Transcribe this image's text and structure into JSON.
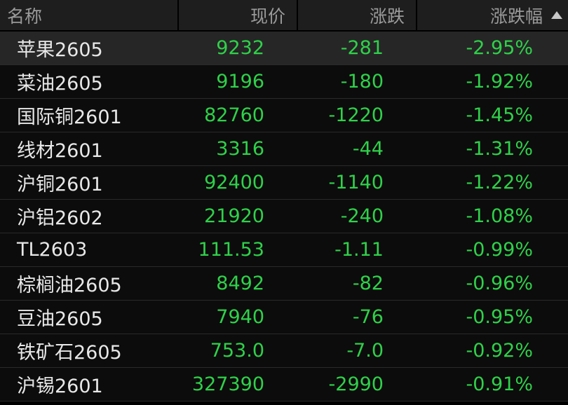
{
  "colors": {
    "down": "#2fd14a",
    "text": "#e8e8e8",
    "header_text": "#9a9a9a",
    "header_bg": "#1e1e1e",
    "selected_row_bg": "#262626"
  },
  "header": {
    "name": "名称",
    "price": "现价",
    "change": "涨跌",
    "pct": "涨跌幅",
    "sort_icon": "sort-ascending-triangle-icon"
  },
  "rows": [
    {
      "name": "苹果2605",
      "price": "9232",
      "change": "-281",
      "pct": "-2.95%"
    },
    {
      "name": "菜油2605",
      "price": "9196",
      "change": "-180",
      "pct": "-1.92%"
    },
    {
      "name": "国际铜2601",
      "price": "82760",
      "change": "-1220",
      "pct": "-1.45%"
    },
    {
      "name": "线材2601",
      "price": "3316",
      "change": "-44",
      "pct": "-1.31%"
    },
    {
      "name": "沪铜2601",
      "price": "92400",
      "change": "-1140",
      "pct": "-1.22%"
    },
    {
      "name": "沪铝2602",
      "price": "21920",
      "change": "-240",
      "pct": "-1.08%"
    },
    {
      "name": "TL2603",
      "price": "111.53",
      "change": "-1.11",
      "pct": "-0.99%"
    },
    {
      "name": "棕榈油2605",
      "price": "8492",
      "change": "-82",
      "pct": "-0.96%"
    },
    {
      "name": "豆油2605",
      "price": "7940",
      "change": "-76",
      "pct": "-0.95%"
    },
    {
      "name": "铁矿石2605",
      "price": "753.0",
      "change": "-7.0",
      "pct": "-0.92%"
    },
    {
      "name": "沪锡2601",
      "price": "327390",
      "change": "-2990",
      "pct": "-0.91%"
    }
  ]
}
